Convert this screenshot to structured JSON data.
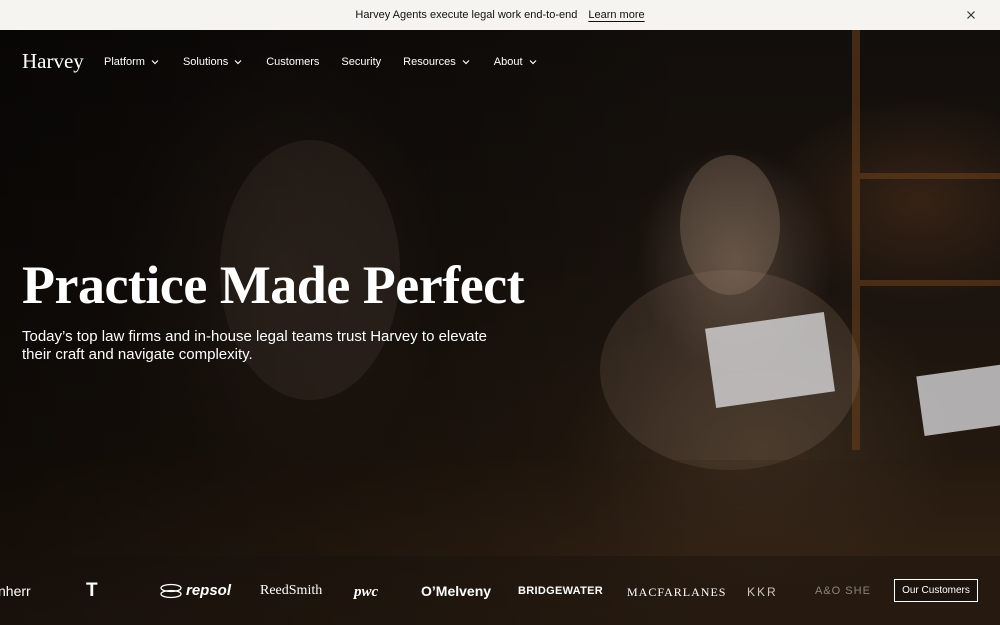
{
  "announcement": {
    "message": "Harvey Agents execute legal work end-to-end",
    "link": "Learn more",
    "close_icon": "close-icon"
  },
  "nav": {
    "logo": "Harvey",
    "items": [
      {
        "label": "Platform",
        "dropdown": true
      },
      {
        "label": "Solutions",
        "dropdown": true
      },
      {
        "label": "Customers",
        "dropdown": false
      },
      {
        "label": "Security",
        "dropdown": false
      },
      {
        "label": "Resources",
        "dropdown": true
      },
      {
        "label": "About",
        "dropdown": true
      }
    ]
  },
  "hero": {
    "headline": "Practice Made Perfect",
    "subhead": "Today’s top law firms and in-house legal teams trust Harvey to elevate their craft and navigate complexity."
  },
  "clients": {
    "logos": [
      "nherr",
      "T",
      "repsol",
      "ReedSmith",
      "pwc",
      "O’Melveny",
      "BRIDGEWATER",
      "MACFARLANES",
      "KKR",
      "A&O SHE"
    ],
    "button": "Our Customers"
  },
  "colors": {
    "announcement_bg": "#f5f4f1",
    "hero_bg": "#120e0b",
    "text_light": "#ffffff"
  }
}
